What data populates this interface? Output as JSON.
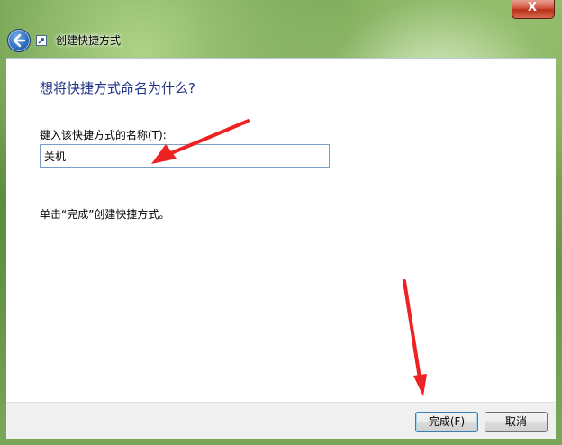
{
  "window": {
    "title": "创建快捷方式",
    "close_label": "X"
  },
  "wizard": {
    "heading": "想将快捷方式命名为什么?",
    "name_label": "键入该快捷方式的名称(T):",
    "name_value": "关机",
    "hint": "单击“完成”创建快捷方式。"
  },
  "buttons": {
    "finish": "完成(F)",
    "cancel": "取消"
  },
  "colors": {
    "heading": "#1e3287",
    "arrow": "#ee2222",
    "input_border": "#7a9cc6"
  },
  "icons": {
    "back": "back-arrow-icon",
    "app": "shortcut-icon",
    "close": "close-icon"
  }
}
